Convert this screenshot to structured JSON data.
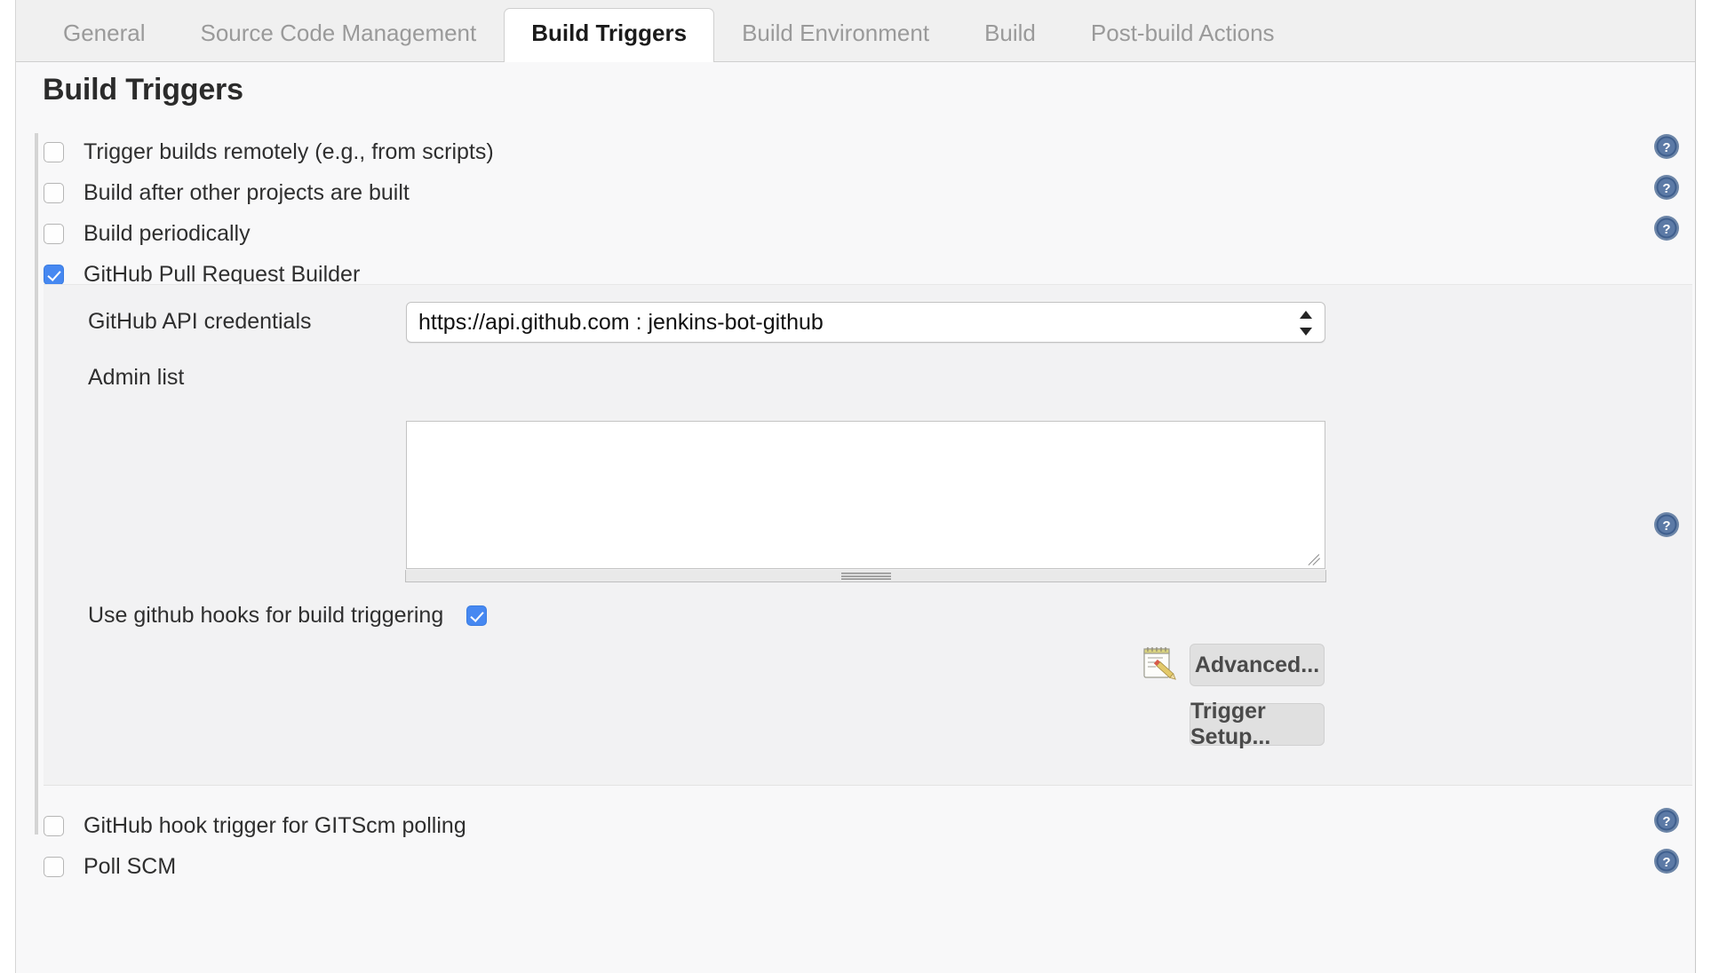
{
  "tabs": [
    {
      "label": "General",
      "active": false
    },
    {
      "label": "Source Code Management",
      "active": false
    },
    {
      "label": "Build Triggers",
      "active": true
    },
    {
      "label": "Build Environment",
      "active": false
    },
    {
      "label": "Build",
      "active": false
    },
    {
      "label": "Post-build Actions",
      "active": false
    }
  ],
  "page": {
    "title": "Build Triggers"
  },
  "triggers": [
    {
      "label": "Trigger builds remotely (e.g., from scripts)",
      "checked": false,
      "help": true
    },
    {
      "label": "Build after other projects are built",
      "checked": false,
      "help": true
    },
    {
      "label": "Build periodically",
      "checked": false,
      "help": true
    },
    {
      "label": "GitHub Pull Request Builder",
      "checked": true,
      "help": false
    },
    {
      "label": "GitHub hook trigger for GITScm polling",
      "checked": false,
      "help": true
    },
    {
      "label": "Poll SCM",
      "checked": false,
      "help": true
    }
  ],
  "ghprb": {
    "credentials": {
      "label": "GitHub API credentials",
      "selected": "https://api.github.com : jenkins-bot-github",
      "options": [
        "https://api.github.com : jenkins-bot-github"
      ]
    },
    "admin_list": {
      "label": "Admin list",
      "value": "",
      "placeholder": ""
    },
    "hooks": {
      "label": "Use github hooks for build triggering",
      "checked": true,
      "help": true
    },
    "advanced_button": "Advanced...",
    "trigger_setup_button": "Trigger Setup..."
  },
  "icons": {
    "help": "help-circle-icon",
    "memo": "memo-notepad-icon",
    "stepper": "select-stepper-icon",
    "resize": "resize-grip-icon"
  },
  "colors": {
    "accent_checkbox": "#4688f1",
    "help_blue": "#4a6a99",
    "page_bg": "#f8f8f9",
    "panel_bg": "#f2f2f3",
    "tabbar_bg": "#f0f0f0"
  }
}
